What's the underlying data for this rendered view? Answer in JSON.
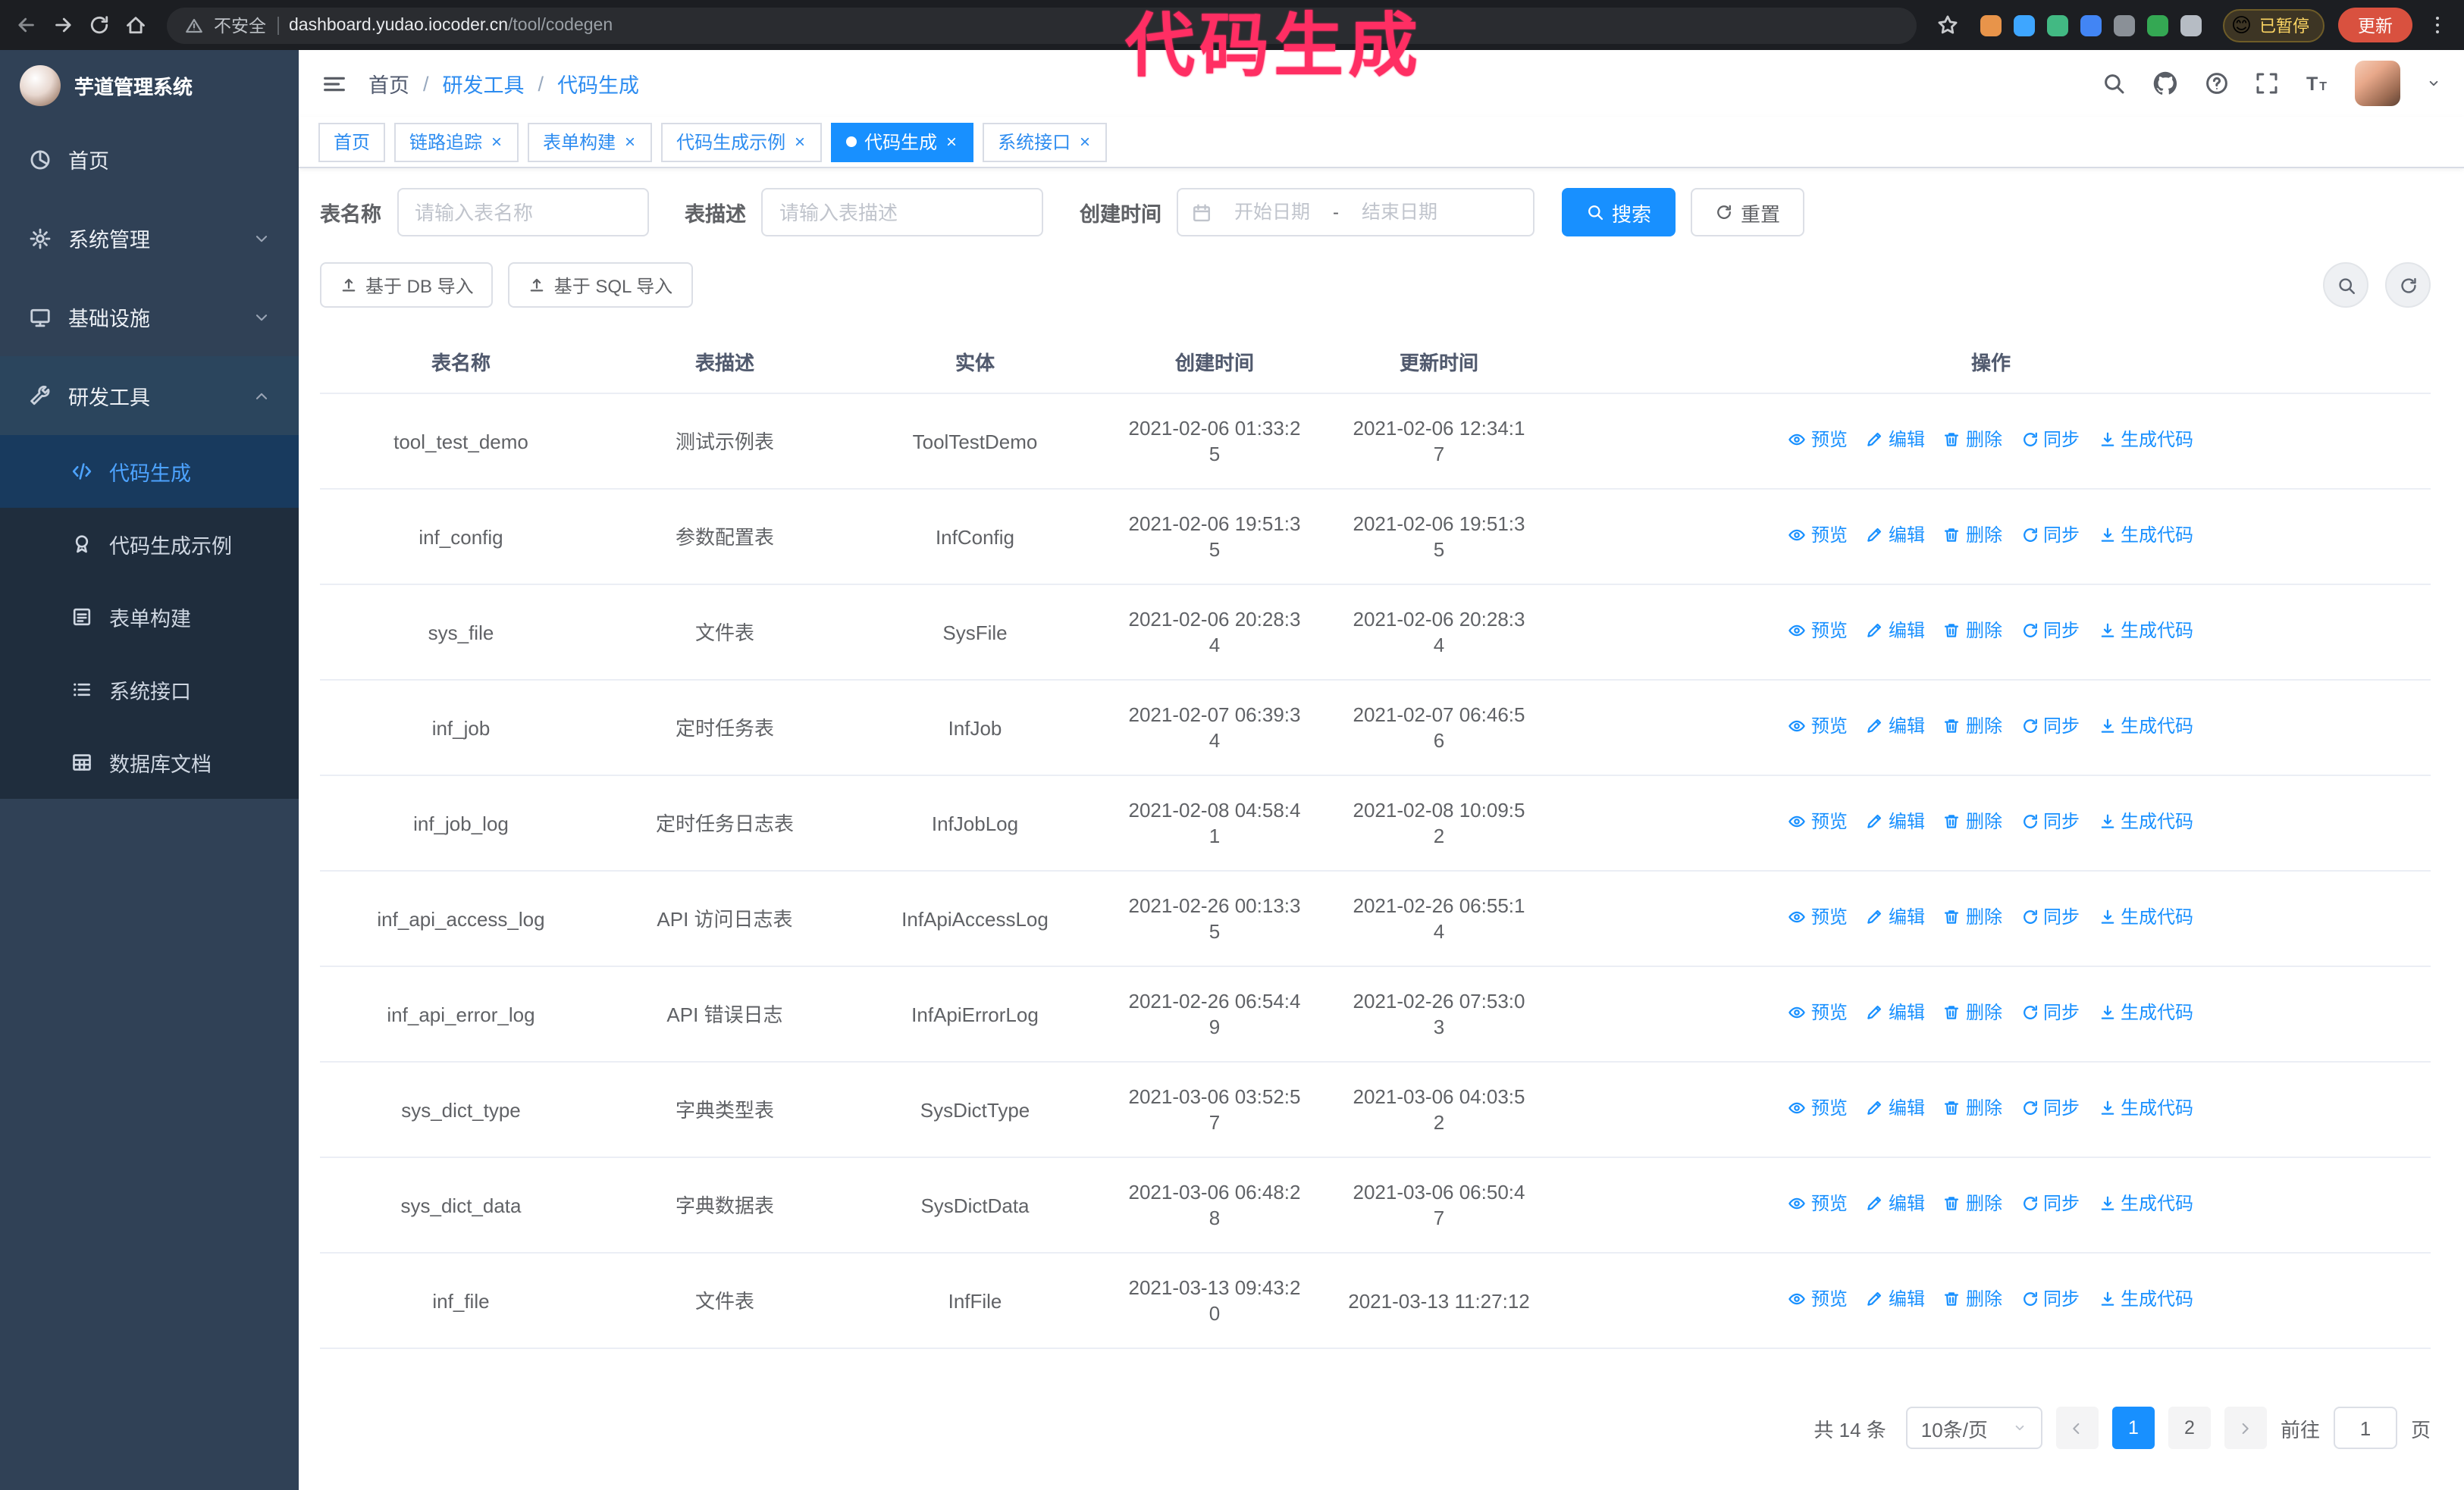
{
  "theme": {
    "accent": "#1890ff",
    "sidebar_bg": "#304156",
    "submenu_bg": "#1f2d3d"
  },
  "annotation": {
    "text": "代码生成",
    "color": "#ff2e63"
  },
  "browser": {
    "insecure_label": "不安全",
    "url_domain": "dashboard.yudao.iocoder.cn",
    "url_path": "/tool/codegen",
    "profile_emoji": "😊",
    "profile_badge": "已暂停",
    "update_button": "更新",
    "extensions": [
      {
        "name": "orange-extension",
        "color": "#e8944a"
      },
      {
        "name": "blue-drop-extension",
        "color": "#3ea6ff"
      },
      {
        "name": "green-check-extension",
        "color": "#42b983"
      },
      {
        "name": "people-extension",
        "color": "#4285f4"
      },
      {
        "name": "gray-extension",
        "color": "#8a9097"
      },
      {
        "name": "leaf-extension",
        "color": "#34a853"
      },
      {
        "name": "puzzle-extension",
        "color": "#b6bcc4"
      }
    ]
  },
  "sidebar": {
    "logo_title": "芋道管理系统",
    "items": [
      {
        "label": "首页",
        "icon": "dashboard-icon"
      },
      {
        "label": "系统管理",
        "icon": "gear-icon"
      },
      {
        "label": "基础设施",
        "icon": "monitor-icon"
      },
      {
        "label": "研发工具",
        "icon": "wrench-icon",
        "expanded": true,
        "children": [
          {
            "label": "代码生成",
            "icon": "code-icon",
            "active": true
          },
          {
            "label": "代码生成示例",
            "icon": "medal-icon"
          },
          {
            "label": "表单构建",
            "icon": "form-icon"
          },
          {
            "label": "系统接口",
            "icon": "list-icon"
          },
          {
            "label": "数据库文档",
            "icon": "table-grid-icon"
          }
        ]
      }
    ]
  },
  "header": {
    "breadcrumb": [
      "首页",
      "研发工具",
      "代码生成"
    ],
    "separator": "/"
  },
  "tabs": [
    {
      "label": "首页",
      "closable": false,
      "active": false
    },
    {
      "label": "链路追踪",
      "closable": true,
      "active": false
    },
    {
      "label": "表单构建",
      "closable": true,
      "active": false
    },
    {
      "label": "代码生成示例",
      "closable": true,
      "active": false
    },
    {
      "label": "代码生成",
      "closable": true,
      "active": true
    },
    {
      "label": "系统接口",
      "closable": true,
      "active": false
    }
  ],
  "filters": {
    "table_name_label": "表名称",
    "table_name_placeholder": "请输入表名称",
    "table_desc_label": "表描述",
    "table_desc_placeholder": "请输入表描述",
    "create_time_label": "创建时间",
    "date_start_placeholder": "开始日期",
    "date_separator": "-",
    "date_end_placeholder": "结束日期",
    "search_label": "搜索",
    "reset_label": "重置"
  },
  "toolbar": {
    "import_db_label": "基于 DB 导入",
    "import_sql_label": "基于 SQL 导入"
  },
  "table": {
    "columns": [
      "表名称",
      "表描述",
      "实体",
      "创建时间",
      "更新时间",
      "操作"
    ],
    "actions": [
      "预览",
      "编辑",
      "删除",
      "同步",
      "生成代码"
    ],
    "rows": [
      {
        "name": "tool_test_demo",
        "desc": "测试示例表",
        "entity": "ToolTestDemo",
        "created": "2021-02-06 01:33:25",
        "updated": "2021-02-06 12:34:17"
      },
      {
        "name": "inf_config",
        "desc": "参数配置表",
        "entity": "InfConfig",
        "created": "2021-02-06 19:51:35",
        "updated": "2021-02-06 19:51:35"
      },
      {
        "name": "sys_file",
        "desc": "文件表",
        "entity": "SysFile",
        "created": "2021-02-06 20:28:34",
        "updated": "2021-02-06 20:28:34"
      },
      {
        "name": "inf_job",
        "desc": "定时任务表",
        "entity": "InfJob",
        "created": "2021-02-07 06:39:34",
        "updated": "2021-02-07 06:46:56"
      },
      {
        "name": "inf_job_log",
        "desc": "定时任务日志表",
        "entity": "InfJobLog",
        "created": "2021-02-08 04:58:41",
        "updated": "2021-02-08 10:09:52"
      },
      {
        "name": "inf_api_access_log",
        "desc": "API 访问日志表",
        "entity": "InfApiAccessLog",
        "created": "2021-02-26 00:13:35",
        "updated": "2021-02-26 06:55:14"
      },
      {
        "name": "inf_api_error_log",
        "desc": "API 错误日志",
        "entity": "InfApiErrorLog",
        "created": "2021-02-26 06:54:49",
        "updated": "2021-02-26 07:53:03"
      },
      {
        "name": "sys_dict_type",
        "desc": "字典类型表",
        "entity": "SysDictType",
        "created": "2021-03-06 03:52:57",
        "updated": "2021-03-06 04:03:52"
      },
      {
        "name": "sys_dict_data",
        "desc": "字典数据表",
        "entity": "SysDictData",
        "created": "2021-03-06 06:48:28",
        "updated": "2021-03-06 06:50:47"
      },
      {
        "name": "inf_file",
        "desc": "文件表",
        "entity": "InfFile",
        "created": "2021-03-13 09:43:20",
        "updated": "2021-03-13 11:27:12"
      }
    ]
  },
  "pagination": {
    "total_label": "共 14 条",
    "page_size": "10条/页",
    "pages": [
      "1",
      "2"
    ],
    "active_page": "1",
    "goto_label": "前往",
    "goto_value": "1",
    "goto_suffix": "页"
  }
}
